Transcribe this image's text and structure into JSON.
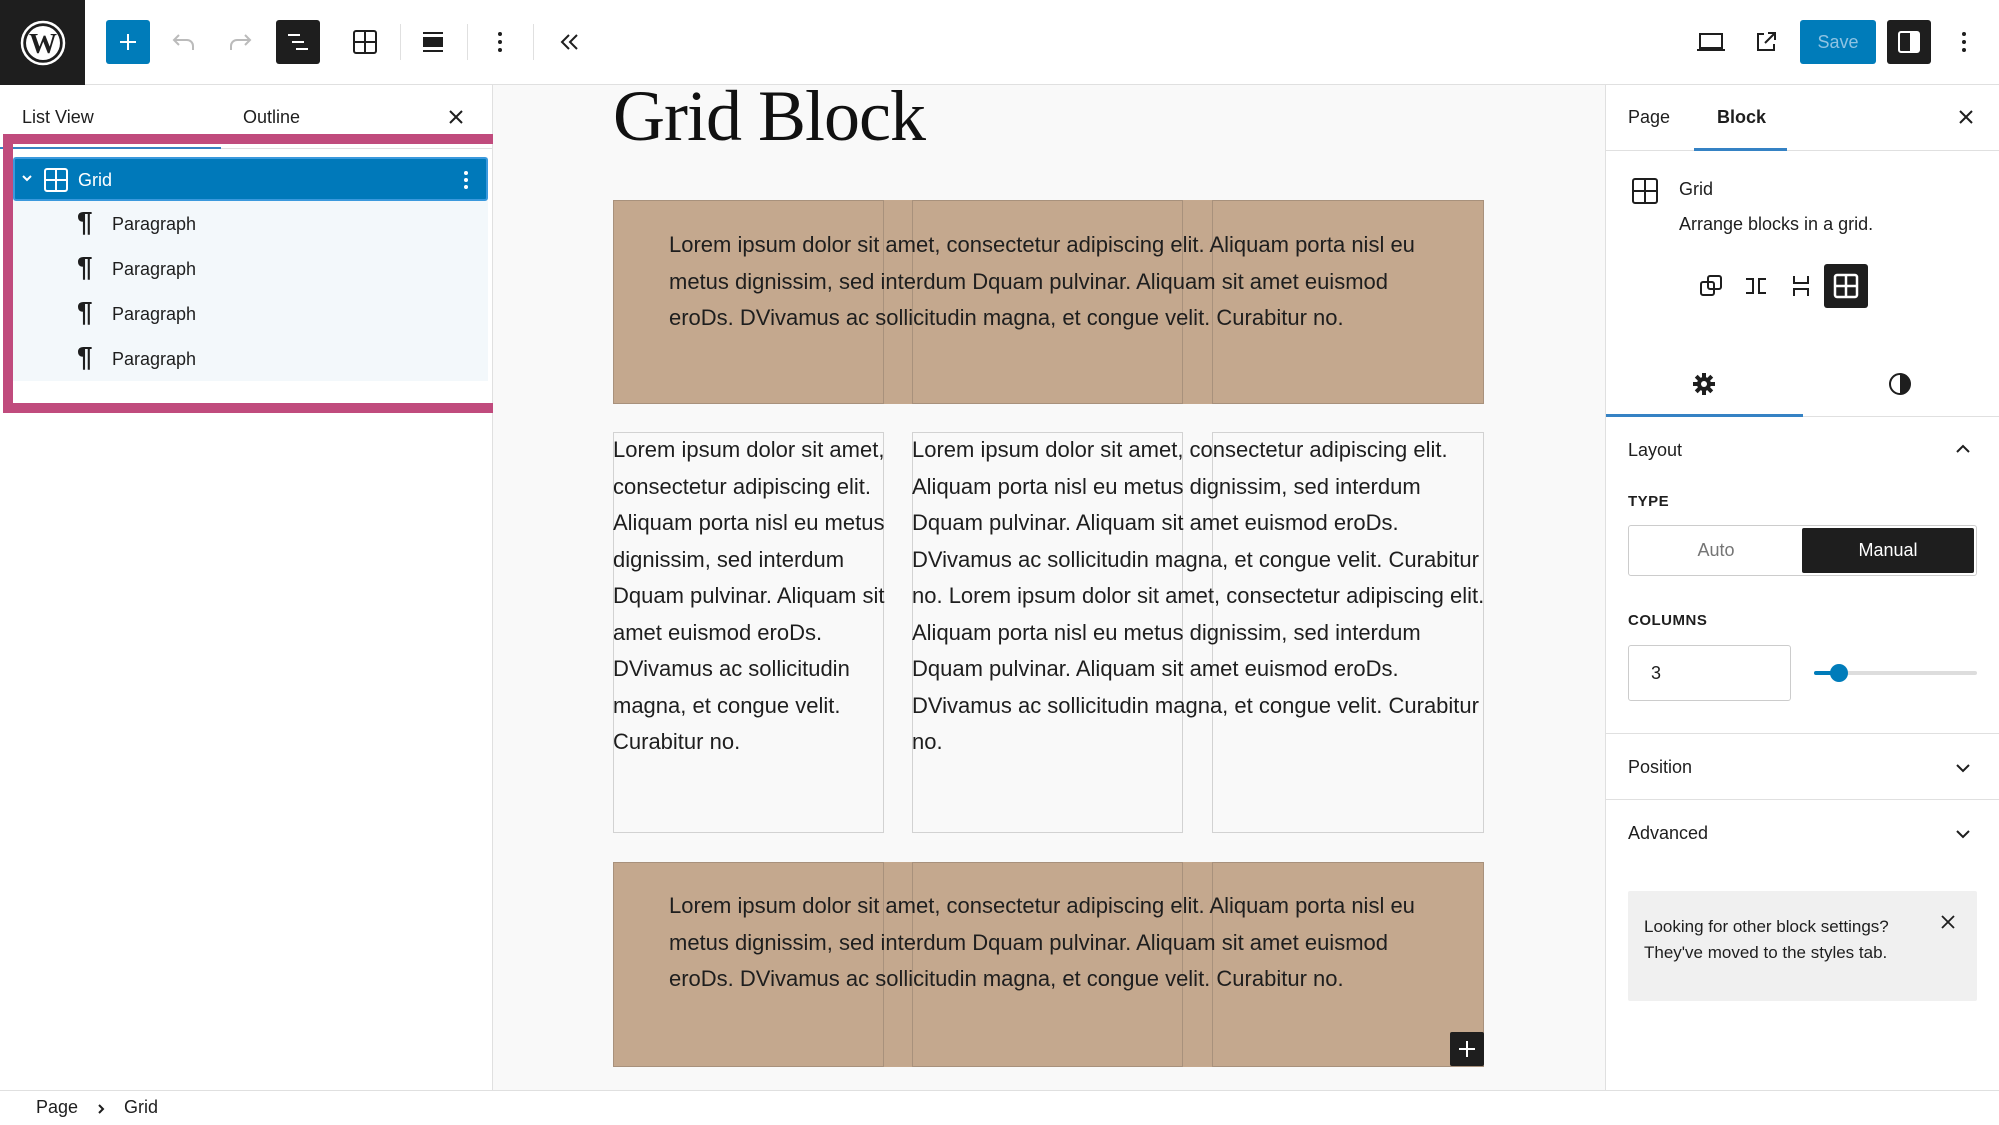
{
  "header": {
    "logo": "wordpress-logo",
    "toolbar_icons": [
      "plus-icon",
      "undo-icon",
      "redo-icon",
      "list-view-icon",
      "grid-icon",
      "align-icon",
      "more-vertical-icon",
      "collapse-icon"
    ],
    "save_label": "Save",
    "right_icons": [
      "desktop-preview-icon",
      "external-link-icon",
      "sidebar-toggle-icon",
      "options-icon"
    ]
  },
  "left_panel": {
    "tabs": [
      {
        "label": "List View",
        "active": true
      },
      {
        "label": "Outline",
        "active": false
      }
    ],
    "tree": {
      "root": {
        "label": "Grid",
        "icon": "grid-icon",
        "expanded": true,
        "selected": true
      },
      "children": [
        {
          "label": "Paragraph",
          "icon": "pilcrow-icon"
        },
        {
          "label": "Paragraph",
          "icon": "pilcrow-icon"
        },
        {
          "label": "Paragraph",
          "icon": "pilcrow-icon"
        },
        {
          "label": "Paragraph",
          "icon": "pilcrow-icon"
        }
      ]
    }
  },
  "canvas": {
    "title": "Grid Block",
    "paragraphs": {
      "wide": "Lorem ipsum dolor sit amet, consectetur adipiscing elit. Aliquam porta nisl eu metus dignissim, sed interdum Dquam pulvinar. Aliquam sit amet euismod eroDs. DVivamus ac sollicitudin magna, et congue velit. Curabitur no.",
      "narrow": "Lorem ipsum dolor sit amet, consectetur adipiscing elit. Aliquam porta nisl eu metus dignissim, sed interdum Dquam pulvinar. Aliquam sit amet euismod eroDs. DVivamus ac sollicitudin magna, et congue velit. Curabitur no.",
      "middle": "Lorem ipsum dolor sit amet, consectetur adipiscing elit. Aliquam porta nisl eu metus dignissim, sed interdum Dquam pulvinar. Aliquam sit amet euismod eroDs. DVivamus ac sollicitudin magna, et congue velit. Curabitur no. Lorem ipsum dolor sit amet, consectetur adipiscing elit. Aliquam porta nisl eu metus dignissim, sed interdum Dquam pulvinar. Aliquam sit amet euismod eroDs. DVivamus ac sollicitudin magna, et congue velit. Curabitur no.",
      "bottom": "Lorem ipsum dolor sit amet, consectetur adipiscing elit. Aliquam porta nisl eu metus dignissim, sed interdum Dquam pulvinar. Aliquam sit amet euismod eroDs. DVivamus ac sollicitudin magna, et congue velit. Curabitur no."
    },
    "tan_color": "#c4a88e"
  },
  "right_panel": {
    "tabs": [
      {
        "label": "Page",
        "active": false
      },
      {
        "label": "Block",
        "active": true
      }
    ],
    "block": {
      "name": "Grid",
      "description": "Arrange blocks in a grid."
    },
    "variations": [
      "group-icon",
      "row-icon",
      "stack-icon",
      "grid-icon"
    ],
    "active_variation": "grid-icon",
    "settings_tabs": [
      "settings-gear-icon",
      "styles-contrast-icon"
    ],
    "layout": {
      "title": "Layout",
      "type_label": "TYPE",
      "type_options": [
        "Auto",
        "Manual"
      ],
      "type_selected": "Manual",
      "columns_label": "COLUMNS",
      "columns_value": "3",
      "columns_slider_fraction": 0.11
    },
    "position_title": "Position",
    "advanced_title": "Advanced",
    "notice": "Looking for other block settings? They've moved to the styles tab."
  },
  "footer": {
    "breadcrumb": [
      "Page",
      "Grid"
    ]
  },
  "colors": {
    "accent": "#007cba",
    "highlight": "#c04b7d",
    "dark": "#1e1e1e"
  }
}
